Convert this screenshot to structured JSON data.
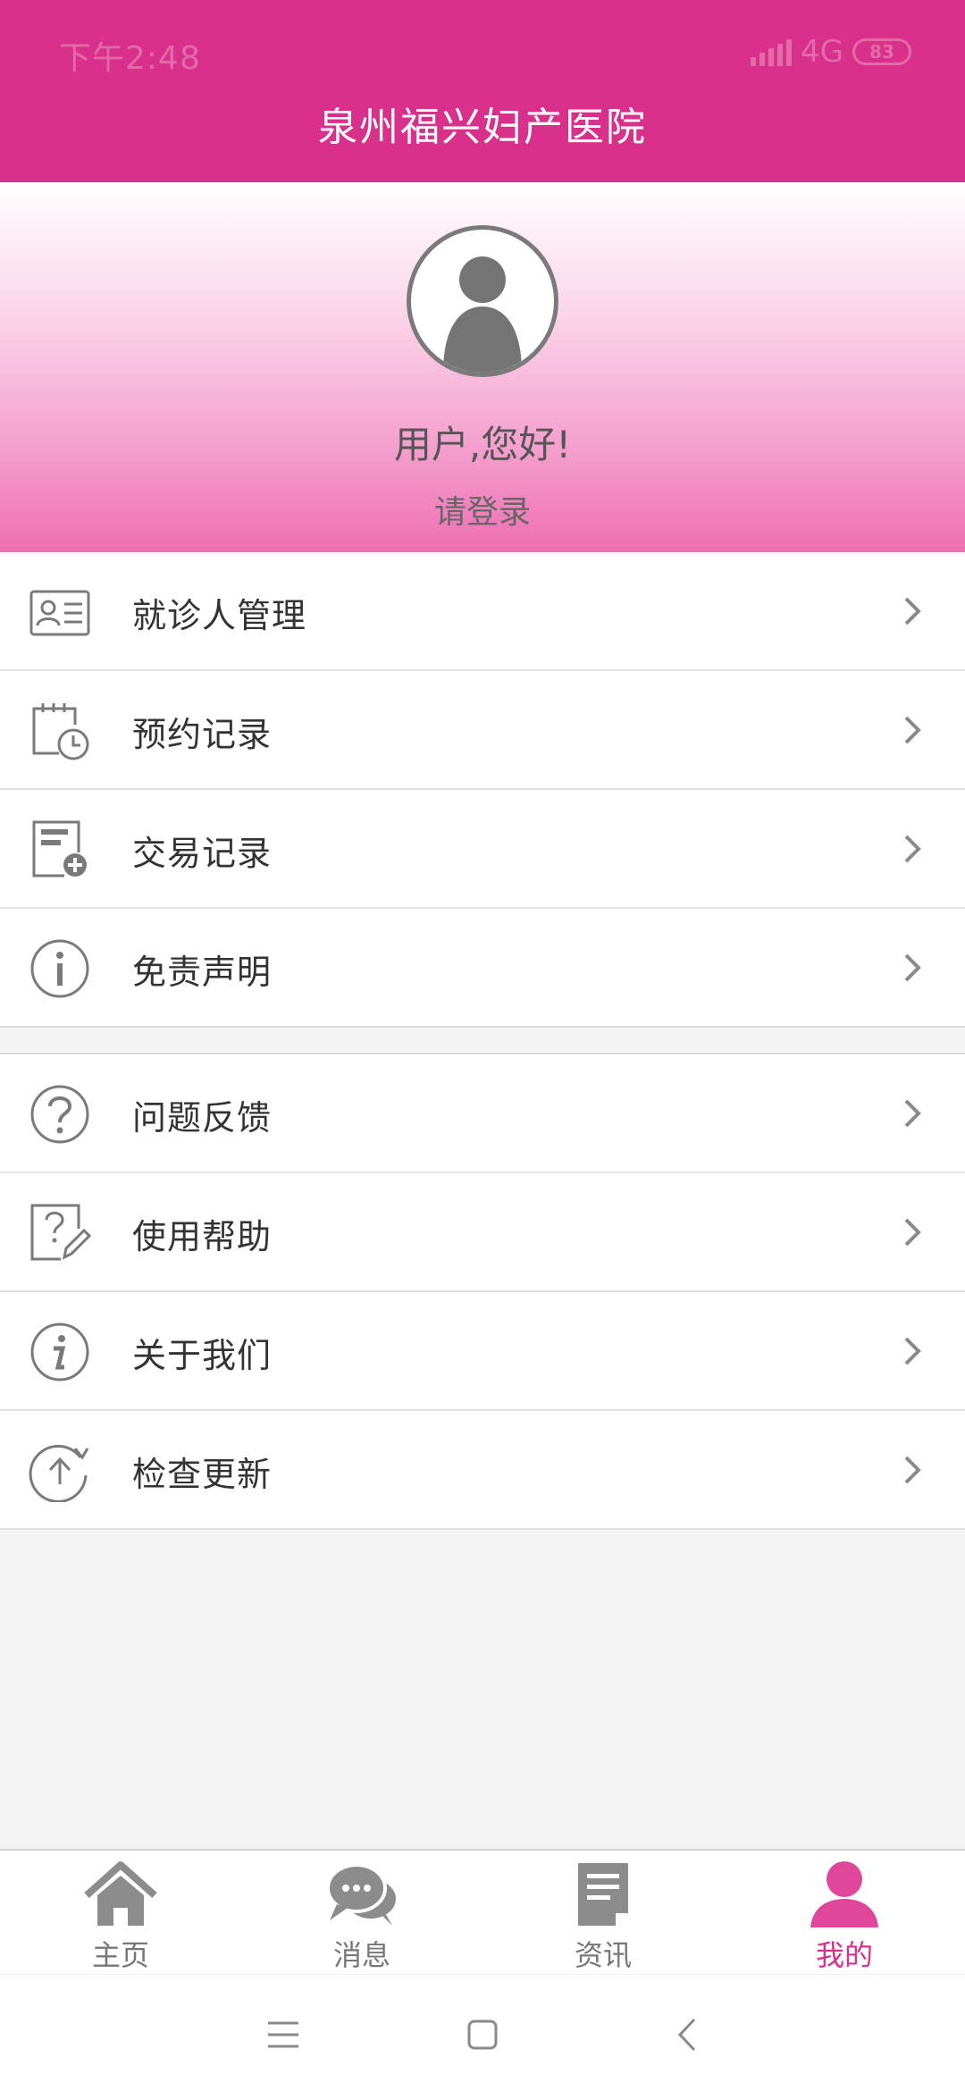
{
  "status_bar": {
    "time": "下午2:48",
    "network": "4G",
    "battery": "83"
  },
  "header": {
    "title": "泉州福兴妇产医院"
  },
  "profile": {
    "greeting": "用户,您好!",
    "login": "请登录"
  },
  "menu": {
    "group1": [
      {
        "label": "就诊人管理",
        "icon": "id-card-icon"
      },
      {
        "label": "预约记录",
        "icon": "calendar-clock-icon"
      },
      {
        "label": "交易记录",
        "icon": "record-add-icon"
      },
      {
        "label": "免责声明",
        "icon": "info-circle-icon"
      }
    ],
    "group2": [
      {
        "label": "问题反馈",
        "icon": "question-circle-icon"
      },
      {
        "label": "使用帮助",
        "icon": "help-edit-icon"
      },
      {
        "label": "关于我们",
        "icon": "about-info-icon"
      },
      {
        "label": "检查更新",
        "icon": "upload-refresh-icon"
      }
    ]
  },
  "tabs": [
    {
      "label": "主页",
      "icon": "home-icon"
    },
    {
      "label": "消息",
      "icon": "chat-icon"
    },
    {
      "label": "资讯",
      "icon": "news-icon"
    },
    {
      "label": "我的",
      "icon": "user-icon",
      "active": true
    }
  ],
  "colors": {
    "brand": "#d9308c",
    "icon_gray": "#7a7a7a"
  }
}
